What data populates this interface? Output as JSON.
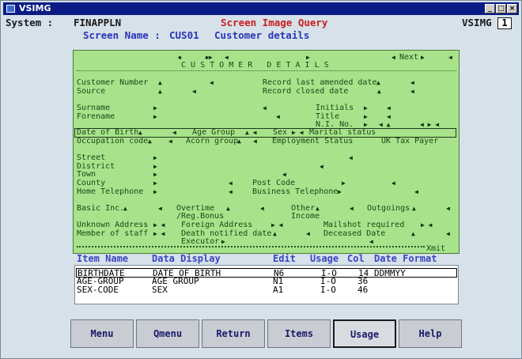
{
  "window": {
    "title": "VSIMG"
  },
  "header": {
    "system_label": "System :",
    "system_value": "FINAPPLN",
    "screen_title": "Screen Image Query",
    "app_id": "VSIMG",
    "page_number": "1",
    "screen_name_label": "Screen Name :",
    "screen_name": "CUS01",
    "screen_desc": "Customer details"
  },
  "screen": {
    "title": "C U S T O M E R   D E T A I L S",
    "next": "Next",
    "labels": {
      "customer_number": "Customer Number",
      "source": "Source",
      "record_last_amended": "Record last amended date",
      "record_closed": "Record closed date",
      "surname": "Surname",
      "forename": "Forename",
      "initials": "Initials",
      "title": "Title",
      "ni_no": "N.I. No.",
      "dob": "Date of Birth",
      "age_group": "Age Group",
      "sex": "Sex",
      "marital": "Marital status",
      "occupation": "Occupation code",
      "acorn": "Acorn group",
      "employment": "Employment Status",
      "uk_tax": "UK Tax Payer",
      "street": "Street",
      "district": "District",
      "town": "Town",
      "county": "County",
      "home_tel": "Home Telephone",
      "post_code": "Post Code",
      "business_tel": "Business Telephone",
      "basic_inc": "Basic Inc.",
      "overtime": "Overtime",
      "reg_bonus": "/Reg.Bonus",
      "other": "Other",
      "income": "Income",
      "outgoings": "Outgoings",
      "unknown_addr": "Unknown Address",
      "foreign_addr": "Foreign Address",
      "mailshot": "Mailshot required",
      "member_staff": "Member of staff",
      "death_notified": "Death notified date",
      "deceased": "Deceased Date",
      "executor": "Executor",
      "xmit": "Xmit"
    }
  },
  "columns": {
    "item_name": "Item Name",
    "data_display": "Data Display",
    "edit": "Edit",
    "usage": "Usage",
    "col": "Col",
    "date_format": "Date Format"
  },
  "items": [
    {
      "name": "BIRTHDATE",
      "display": "DATE OF BIRTH",
      "edit": "N6",
      "usage": "I-O",
      "col": "14",
      "date_format": "DDMMYY"
    },
    {
      "name": "AGE-GROUP",
      "display": "AGE GROUP",
      "edit": "N1",
      "usage": "I-O",
      "col": "36",
      "date_format": ""
    },
    {
      "name": "SEX-CODE",
      "display": "SEX",
      "edit": "A1",
      "usage": "I-O",
      "col": "46",
      "date_format": ""
    }
  ],
  "buttons": {
    "menu": "Menu",
    "qmenu": "Qmenu",
    "return": "Return",
    "items": "Items",
    "usage": "Usage",
    "help": "Help"
  },
  "colors": {
    "titlebar": "#0a1b84",
    "screen_bg": "#a8e28a",
    "header_red": "#c81e1e",
    "header_blue": "#2a35b8",
    "column_blue": "#3a44c0"
  }
}
